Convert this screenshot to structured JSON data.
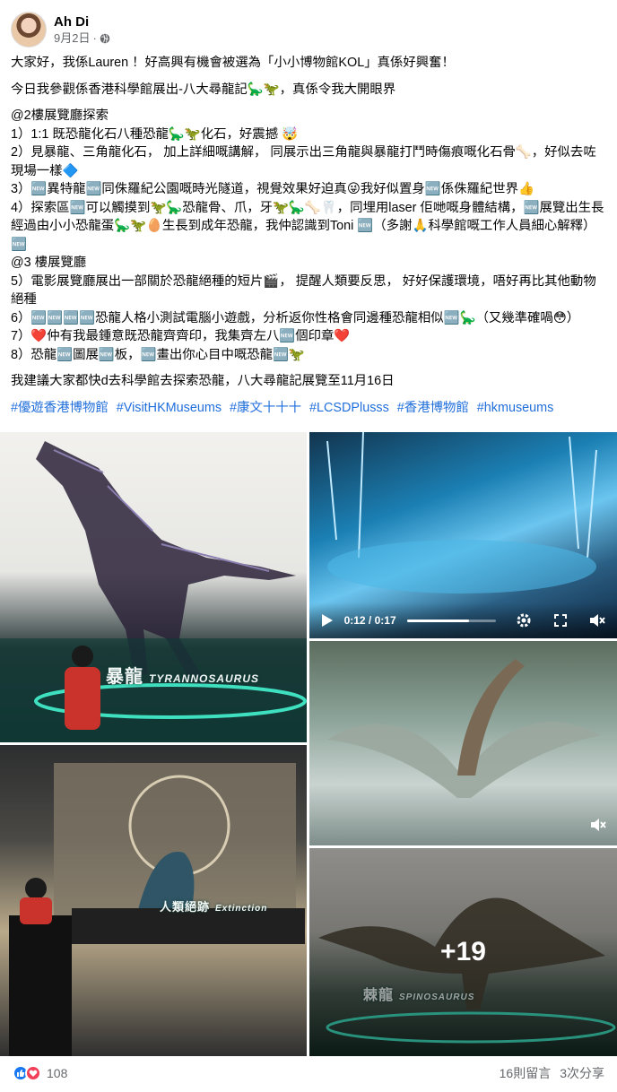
{
  "post": {
    "author": "Ah Di",
    "date": "9月2日",
    "separator": "·",
    "privacy_icon": "globe-icon",
    "paragraphs": [
      "大家好，我係Lauren ！好高興有機會被選為「小小博物館KOL」真係好興奮！",
      "今日我參觀係香港科學館展出-八大尋龍記🦕🦖，真係令我大開眼界",
      "@2樓展覽廳探索\n1）1:1 既恐龍化石八種恐龍🦕🦖化石，好震撼 🤯\n2）見暴龍、三角龍化石， 加上詳細嘅講解， 同展示出三角龍與暴龍打鬥時傷痕嘅化石骨🦴，好似去咗現場一樣🔷\n3）🆕異特龍🆕同侏羅紀公園嘅時光隧道，視覺效果好迫真😜我好似置身🆕係侏羅紀世界👍\n4）探索區🆕可以觸摸到🦖🦕恐龍骨、爪，牙🦖🦕🦴🦷，同埋用laser 佢哋嘅身體結構，🆕展覽出生長經過由小小恐龍蛋🦕🦖🥚生長到成年恐龍，我仲認識到Toni 🆕（多謝🙏科學館嘅工作人員細心解釋）🆕\n@3 樓展覽廳\n5）電影展覽廳展出一部關於恐龍絕種的短片🎬， 提醒人類要反思， 好好保護環境，唔好再比其他動物絕種\n6）🆕🆕🆕🆕恐龍人格小測試電腦小遊戲，分析返你性格會同邊種恐龍相似🆕🦕（又幾準確喎😳）\n7）❤️仲有我最鍾意既恐龍齊齊印，我集齊左八🆕個印章❤️\n8）恐龍🆕圖展🆕板，🆕畫出你心目中嘅恐龍🆕🦖",
      "我建議大家都快d去科學館去探索恐龍，八大尋龍記展覽至11月16日"
    ],
    "hashtags": [
      "#優遊香港博物館",
      "#VisitHKMuseums",
      "#康文十十十",
      "#LCSDPlusss",
      "#香港博物館",
      "#hkmuseums"
    ]
  },
  "gallery": {
    "photo1_sign": "暴龍",
    "photo1_sign_sub": "TYRANNOSAURUS",
    "video": {
      "time": "0:12 / 0:17",
      "progress": 0.7,
      "icons": [
        "play-icon",
        "settings-icon",
        "fullscreen-icon",
        "mute-icon"
      ]
    },
    "photo3_icon": "mute-icon",
    "photo4_screen_text": "人類絕跡",
    "photo4_screen_sub": "Extinction",
    "photo5_sign": "棘龍",
    "photo5_sign_sub": "SPINOSAURUS",
    "more_count": "+19"
  },
  "footer": {
    "reaction_icons": [
      "like-icon",
      "love-icon"
    ],
    "reaction_count": "108",
    "comments": "16則留言",
    "shares": "3次分享"
  },
  "colors": {
    "hashtag": "#216fdb",
    "like": "#1877f2",
    "love": "#f33e58",
    "muted_text": "#65676b"
  }
}
